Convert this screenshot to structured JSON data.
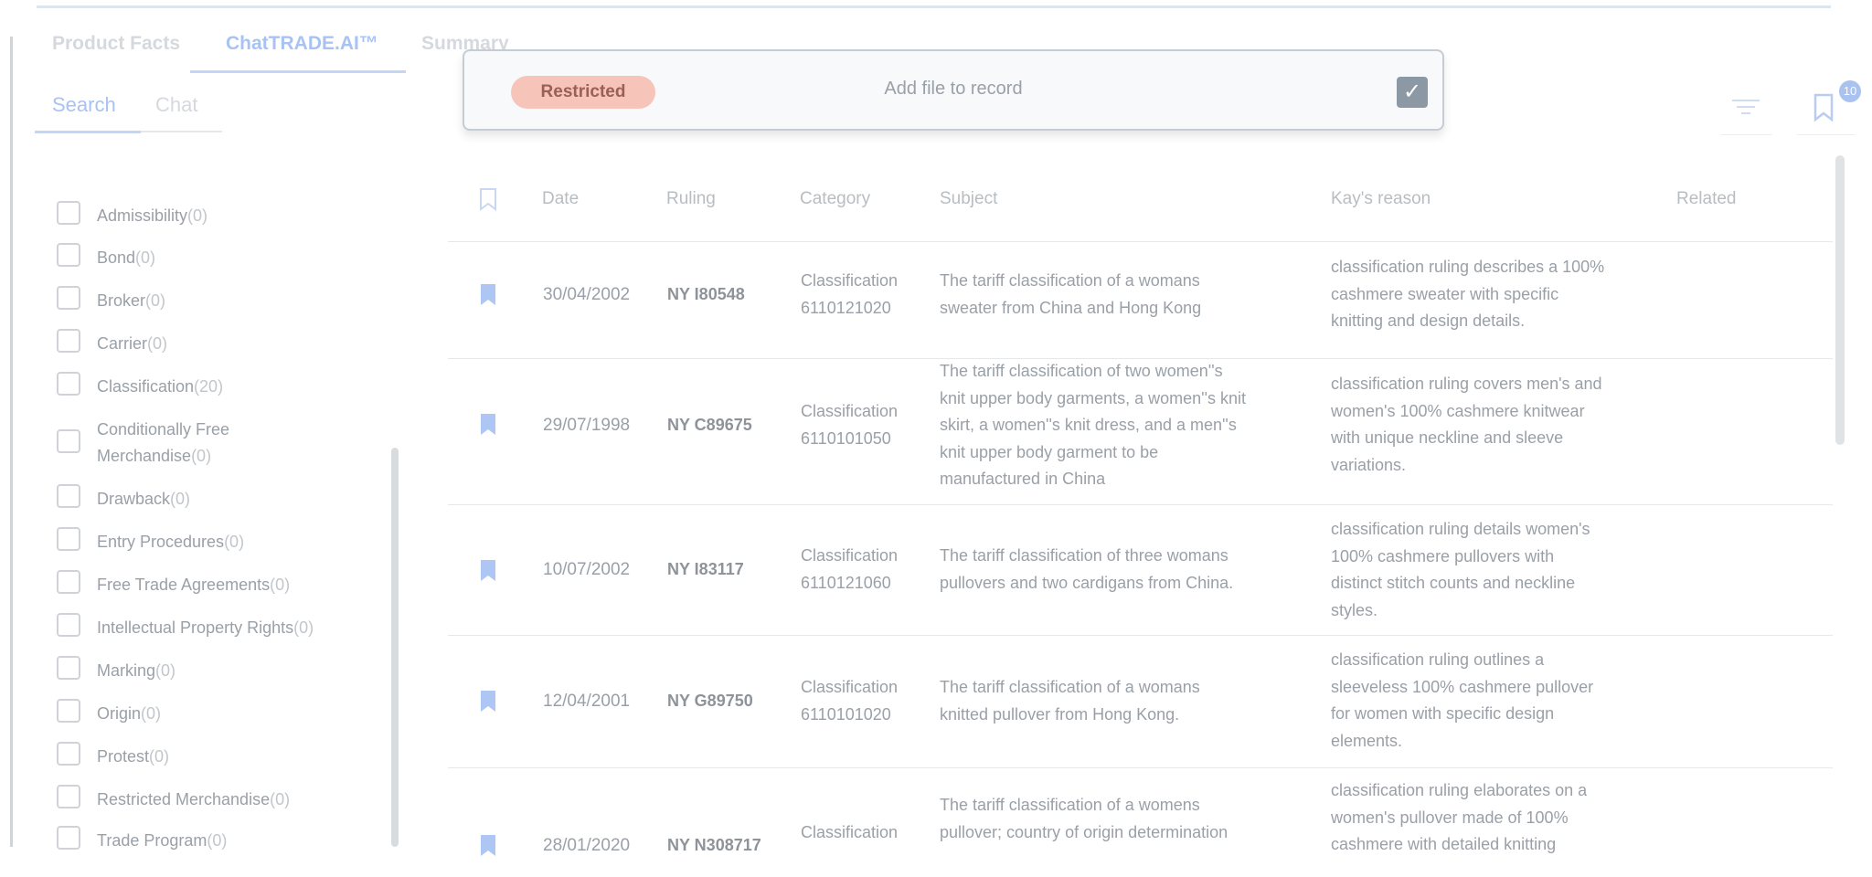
{
  "main_tabs": [
    "Product Facts",
    "ChatTRADE.AI™",
    "Summary"
  ],
  "sub_tabs": [
    "Search",
    "Chat"
  ],
  "filters": [
    {
      "label": "Admissibility",
      "count": "(0)"
    },
    {
      "label": "Bond",
      "count": "(0)"
    },
    {
      "label": "Broker",
      "count": "(0)"
    },
    {
      "label": "Carrier",
      "count": "(0)"
    },
    {
      "label": "Classification",
      "count": "(20)"
    },
    {
      "label": "Conditionally Free Merchandise",
      "count": "(0)"
    },
    {
      "label": "Drawback",
      "count": "(0)"
    },
    {
      "label": "Entry Procedures",
      "count": "(0)"
    },
    {
      "label": "Free Trade Agreements",
      "count": "(0)"
    },
    {
      "label": "Intellectual Property Rights",
      "count": "(0)"
    },
    {
      "label": "Marking",
      "count": "(0)"
    },
    {
      "label": "Origin",
      "count": "(0)"
    },
    {
      "label": "Protest",
      "count": "(0)"
    },
    {
      "label": "Restricted Merchandise",
      "count": "(0)"
    },
    {
      "label": "Trade Program",
      "count": "(0)"
    }
  ],
  "modal": {
    "badge": "Restricted",
    "text": "Add file to record",
    "check_glyph": "✓"
  },
  "toolbar": {
    "filter_icon": "filter-lines-icon",
    "bookmarks_icon": "bookmark-icon",
    "bookmarks_count": "10"
  },
  "table": {
    "headers": {
      "date": "Date",
      "ruling": "Ruling",
      "category": "Category",
      "subject": "Subject",
      "reason": "Kay's reason",
      "related": "Related"
    },
    "rows": [
      {
        "date": "30/04/2002",
        "ruling": "NY I80548",
        "category": [
          "Classification",
          "6110121020"
        ],
        "subject": [
          "The tariff classification of a womans",
          "sweater from China and Hong Kong"
        ],
        "reason": [
          "classification ruling describes a 100%",
          "cashmere sweater with specific",
          "knitting and design details."
        ]
      },
      {
        "date": "29/07/1998",
        "ruling": "NY C89675",
        "category": [
          "Classification",
          "6110101050"
        ],
        "subject": [
          "The tariff classification of two women''s",
          "knit upper body garments, a women''s knit",
          "skirt, a women''s knit dress, and a men''s",
          "knit upper body garment to be",
          "manufactured in China"
        ],
        "reason": [
          "classification ruling covers men's and",
          "women's 100% cashmere knitwear",
          "with unique neckline and sleeve",
          "variations."
        ]
      },
      {
        "date": "10/07/2002",
        "ruling": "NY I83117",
        "category": [
          "Classification",
          "6110121060"
        ],
        "subject": [
          "The tariff classification of three womans",
          "pullovers and two cardigans from China."
        ],
        "reason": [
          "classification ruling details women's",
          "100% cashmere pullovers with",
          "distinct stitch counts and neckline",
          "styles."
        ]
      },
      {
        "date": "12/04/2001",
        "ruling": "NY G89750",
        "category": [
          "Classification",
          "6110101020"
        ],
        "subject": [
          "The tariff classification of a womans",
          "knitted pullover from Hong Kong."
        ],
        "reason": [
          "classification ruling outlines a",
          "sleeveless 100% cashmere pullover",
          "for women with specific design",
          "elements."
        ]
      },
      {
        "date": "28/01/2020",
        "ruling": "NY N308717",
        "category": [
          "Classification",
          ""
        ],
        "subject": [
          "The tariff classification of a womens",
          "pullover; country of origin determination"
        ],
        "reason": [
          "classification ruling elaborates on a",
          "women's pullover made of 100%",
          "cashmere with detailed knitting"
        ]
      }
    ]
  },
  "colors": {
    "accent": "#a8c3f3",
    "badge_bg": "#f7c4b9",
    "bookmark_fill": "#aec6f4"
  }
}
